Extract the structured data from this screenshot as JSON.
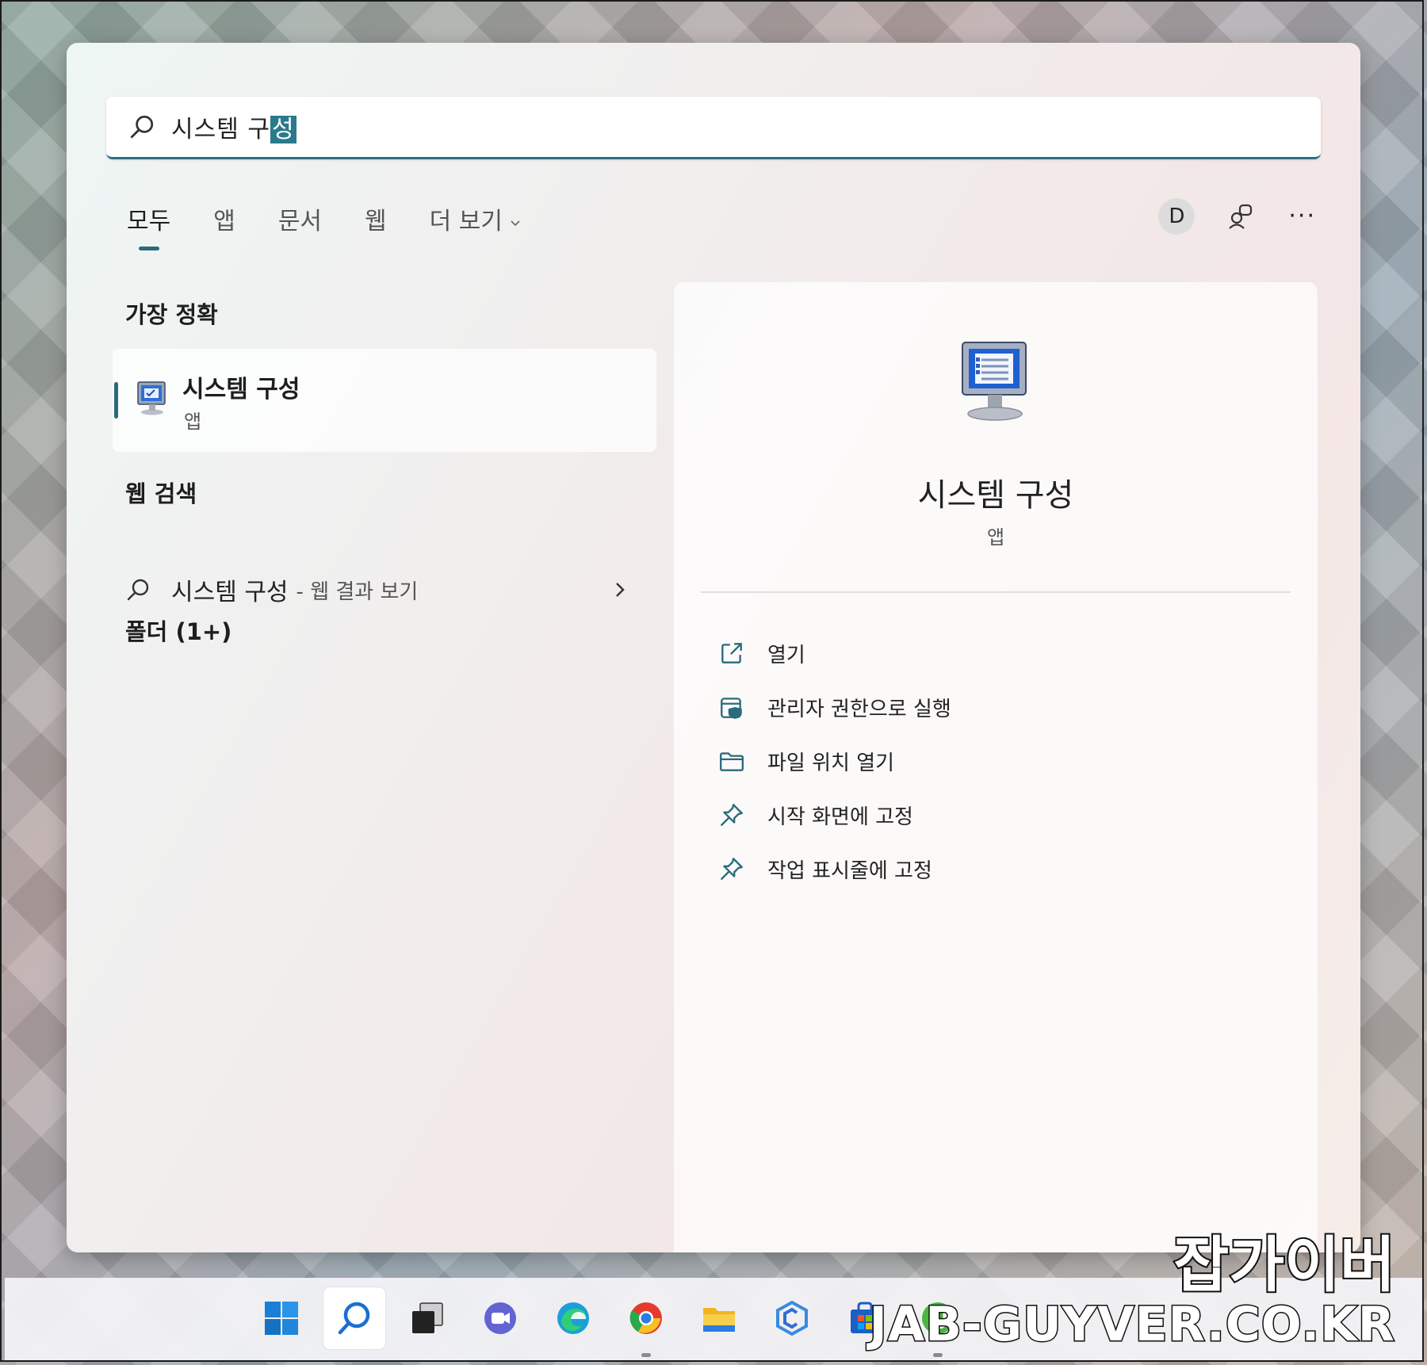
{
  "search": {
    "query_before": "시스템 구",
    "query_selected": "성"
  },
  "tabs": [
    {
      "label": "모두"
    },
    {
      "label": "앱"
    },
    {
      "label": "문서"
    },
    {
      "label": "웹"
    },
    {
      "label": "더 보기"
    }
  ],
  "header": {
    "avatar_letter": "D",
    "more_label": "···"
  },
  "sections": {
    "best_match": "가장 정확",
    "web_search": "웹 검색",
    "folders": "폴더 (1+)"
  },
  "best_match_item": {
    "name": "시스템 구성",
    "type": "앱"
  },
  "web_result": {
    "query": "시스템 구성",
    "suffix": "- 웹 결과 보기"
  },
  "preview": {
    "name": "시스템 구성",
    "type": "앱",
    "actions": [
      {
        "label": "열기",
        "icon": "open-external-icon"
      },
      {
        "label": "관리자 권한으로 실행",
        "icon": "admin-shield-icon"
      },
      {
        "label": "파일 위치 열기",
        "icon": "folder-icon"
      },
      {
        "label": "시작 화면에 고정",
        "icon": "pin-icon"
      },
      {
        "label": "작업 표시줄에 고정",
        "icon": "pin-icon"
      }
    ]
  },
  "taskbar": {
    "items": [
      "windows-start-icon",
      "search-icon",
      "task-view-icon",
      "chat-icon",
      "edge-icon",
      "chrome-icon",
      "file-explorer-icon",
      "app-icon",
      "store-icon",
      "utorrent-icon"
    ]
  },
  "watermark": {
    "korean": "잡가이버",
    "url": "JAB-GUYVER.CO.KR"
  }
}
